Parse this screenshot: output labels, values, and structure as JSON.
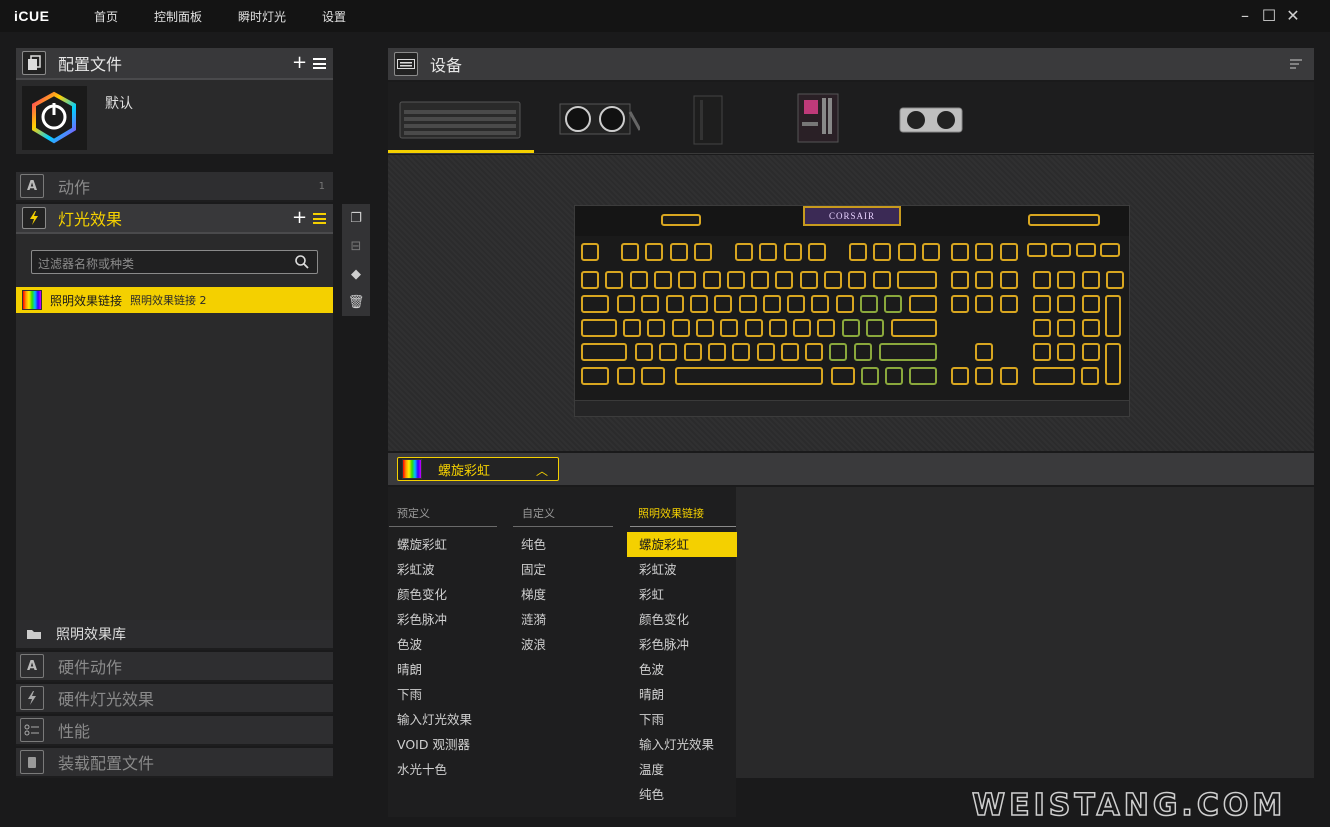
{
  "app": {
    "brand": "iCUE"
  },
  "nav": {
    "home": "首页",
    "dashboard": "控制面板",
    "instant_lighting": "瞬时灯光",
    "settings": "设置"
  },
  "profiles": {
    "header": "配置文件",
    "default_profile": "默认"
  },
  "sidebar": {
    "actions": {
      "label": "动作",
      "count": "1"
    },
    "lighting_effects": {
      "label": "灯光效果"
    },
    "filter_placeholder": "过滤器名称或种类",
    "selected_effect": {
      "name": "照明效果链接",
      "sub": "照明效果链接 2"
    },
    "lighting_library": "照明效果库",
    "hardware_actions": "硬件动作",
    "hardware_lighting": "硬件灯光效果",
    "performance": "性能",
    "load_profile": "装载配置文件"
  },
  "devices": {
    "header": "设备"
  },
  "effect_picker": {
    "current": "螺旋彩虹",
    "columns": {
      "predefined": "预定义",
      "custom": "自定义",
      "link": "照明效果链接"
    },
    "predefined_items": [
      "螺旋彩虹",
      "彩虹波",
      "颜色变化",
      "彩色脉冲",
      "色波",
      "晴朗",
      "下雨",
      "输入灯光效果",
      "VOID 观测器",
      "水光十色"
    ],
    "custom_items": [
      "纯色",
      "固定",
      "梯度",
      "涟漪",
      "波浪"
    ],
    "link_items": [
      "螺旋彩虹",
      "彩虹波",
      "彩虹",
      "颜色变化",
      "彩色脉冲",
      "色波",
      "晴朗",
      "下雨",
      "输入灯光效果",
      "温度",
      "纯色"
    ]
  },
  "keyboard": {
    "logo": "CORSAIR"
  },
  "watermark": "WEISTANG.COM",
  "colors": {
    "accent": "#f4d000",
    "key_border": "#d8a620"
  }
}
